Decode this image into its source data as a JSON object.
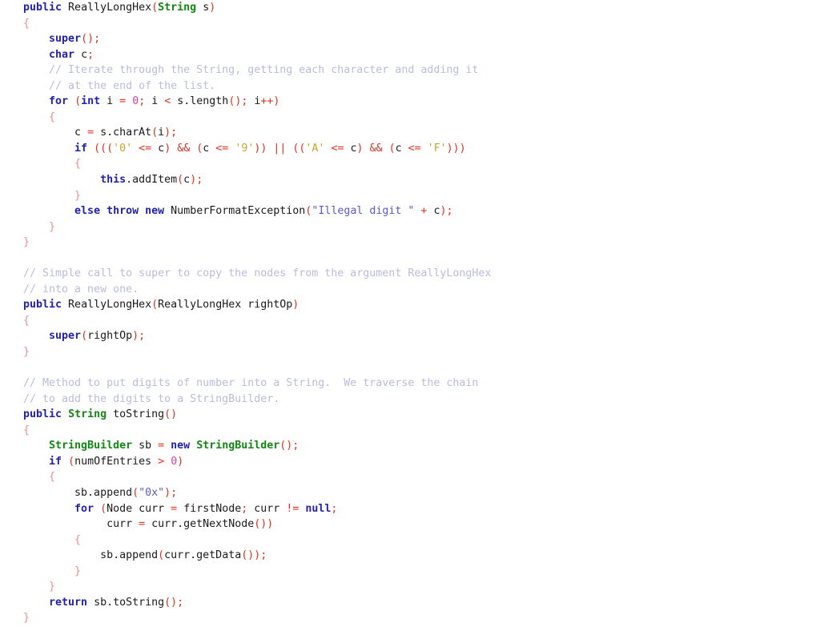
{
  "editor": {
    "language": "Java",
    "class_name": "ReallyLongHex",
    "background_color": "#ffffff",
    "plain_text_color": "#1a1a1a",
    "theme": {
      "keyword_color": "#2222aa",
      "type_color": "#128712",
      "comment_color": "#b9bcdb",
      "string_color": "#5a5ac8",
      "char_literal_color": "#c8a32a",
      "number_color": "#d4419c",
      "punctuation_color": "#dd3322",
      "brace_color": "#e89090"
    }
  },
  "code": {
    "lines": [
      {
        "n": 1,
        "tokens": [
          {
            "t": "kw",
            "v": "public"
          },
          {
            "t": "plain",
            "v": " ReallyLongHex"
          },
          {
            "t": "punc",
            "v": "("
          },
          {
            "t": "type",
            "v": "String"
          },
          {
            "t": "plain",
            "v": " s"
          },
          {
            "t": "punc",
            "v": ")"
          }
        ]
      },
      {
        "n": 2,
        "tokens": [
          {
            "t": "brace",
            "v": "{"
          }
        ]
      },
      {
        "n": 3,
        "tokens": [
          {
            "t": "plain",
            "v": "    "
          },
          {
            "t": "kw",
            "v": "super"
          },
          {
            "t": "punc",
            "v": "();"
          }
        ]
      },
      {
        "n": 4,
        "tokens": [
          {
            "t": "plain",
            "v": "    "
          },
          {
            "t": "kw",
            "v": "char"
          },
          {
            "t": "plain",
            "v": " c"
          },
          {
            "t": "punc",
            "v": ";"
          }
        ]
      },
      {
        "n": 5,
        "tokens": [
          {
            "t": "plain",
            "v": "    "
          },
          {
            "t": "comment",
            "v": "// Iterate through the String, getting each character and adding it"
          }
        ]
      },
      {
        "n": 6,
        "tokens": [
          {
            "t": "plain",
            "v": "    "
          },
          {
            "t": "comment",
            "v": "// at the end of the list."
          }
        ]
      },
      {
        "n": 7,
        "tokens": [
          {
            "t": "plain",
            "v": "    "
          },
          {
            "t": "kw",
            "v": "for"
          },
          {
            "t": "plain",
            "v": " "
          },
          {
            "t": "punc",
            "v": "("
          },
          {
            "t": "kw",
            "v": "int"
          },
          {
            "t": "plain",
            "v": " i "
          },
          {
            "t": "punc",
            "v": "="
          },
          {
            "t": "plain",
            "v": " "
          },
          {
            "t": "num",
            "v": "0"
          },
          {
            "t": "punc",
            "v": ";"
          },
          {
            "t": "plain",
            "v": " i "
          },
          {
            "t": "punc",
            "v": "<"
          },
          {
            "t": "plain",
            "v": " s.length"
          },
          {
            "t": "punc",
            "v": "();"
          },
          {
            "t": "plain",
            "v": " i"
          },
          {
            "t": "punc",
            "v": "++)"
          }
        ]
      },
      {
        "n": 8,
        "tokens": [
          {
            "t": "plain",
            "v": "    "
          },
          {
            "t": "brace",
            "v": "{"
          }
        ]
      },
      {
        "n": 9,
        "tokens": [
          {
            "t": "plain",
            "v": "        c "
          },
          {
            "t": "punc",
            "v": "="
          },
          {
            "t": "plain",
            "v": " s.charAt"
          },
          {
            "t": "punc",
            "v": "("
          },
          {
            "t": "plain",
            "v": "i"
          },
          {
            "t": "punc",
            "v": ");"
          }
        ]
      },
      {
        "n": 10,
        "tokens": [
          {
            "t": "plain",
            "v": "        "
          },
          {
            "t": "kw",
            "v": "if"
          },
          {
            "t": "plain",
            "v": " "
          },
          {
            "t": "punc",
            "v": "((("
          },
          {
            "t": "char",
            "v": "'0'"
          },
          {
            "t": "plain",
            "v": " "
          },
          {
            "t": "punc",
            "v": "<="
          },
          {
            "t": "plain",
            "v": " c"
          },
          {
            "t": "punc",
            "v": ")"
          },
          {
            "t": "plain",
            "v": " "
          },
          {
            "t": "punc",
            "v": "&&"
          },
          {
            "t": "plain",
            "v": " "
          },
          {
            "t": "punc",
            "v": "("
          },
          {
            "t": "plain",
            "v": "c "
          },
          {
            "t": "punc",
            "v": "<="
          },
          {
            "t": "plain",
            "v": " "
          },
          {
            "t": "char",
            "v": "'9'"
          },
          {
            "t": "punc",
            "v": "))"
          },
          {
            "t": "plain",
            "v": " "
          },
          {
            "t": "punc",
            "v": "||"
          },
          {
            "t": "plain",
            "v": " "
          },
          {
            "t": "punc",
            "v": "(("
          },
          {
            "t": "char",
            "v": "'A'"
          },
          {
            "t": "plain",
            "v": " "
          },
          {
            "t": "punc",
            "v": "<="
          },
          {
            "t": "plain",
            "v": " c"
          },
          {
            "t": "punc",
            "v": ")"
          },
          {
            "t": "plain",
            "v": " "
          },
          {
            "t": "punc",
            "v": "&&"
          },
          {
            "t": "plain",
            "v": " "
          },
          {
            "t": "punc",
            "v": "("
          },
          {
            "t": "plain",
            "v": "c "
          },
          {
            "t": "punc",
            "v": "<="
          },
          {
            "t": "plain",
            "v": " "
          },
          {
            "t": "char",
            "v": "'F'"
          },
          {
            "t": "punc",
            "v": ")))"
          }
        ]
      },
      {
        "n": 11,
        "tokens": [
          {
            "t": "plain",
            "v": "        "
          },
          {
            "t": "brace",
            "v": "{"
          }
        ]
      },
      {
        "n": 12,
        "tokens": [
          {
            "t": "plain",
            "v": "            "
          },
          {
            "t": "kw",
            "v": "this"
          },
          {
            "t": "plain",
            "v": ".addItem"
          },
          {
            "t": "punc",
            "v": "("
          },
          {
            "t": "plain",
            "v": "c"
          },
          {
            "t": "punc",
            "v": ");"
          }
        ]
      },
      {
        "n": 13,
        "tokens": [
          {
            "t": "plain",
            "v": "        "
          },
          {
            "t": "brace",
            "v": "}"
          }
        ]
      },
      {
        "n": 14,
        "tokens": [
          {
            "t": "plain",
            "v": "        "
          },
          {
            "t": "kw",
            "v": "else"
          },
          {
            "t": "plain",
            "v": " "
          },
          {
            "t": "kw",
            "v": "throw"
          },
          {
            "t": "plain",
            "v": " "
          },
          {
            "t": "kw",
            "v": "new"
          },
          {
            "t": "plain",
            "v": " NumberFormatException"
          },
          {
            "t": "punc",
            "v": "("
          },
          {
            "t": "string",
            "v": "\"Illegal digit \""
          },
          {
            "t": "plain",
            "v": " "
          },
          {
            "t": "punc",
            "v": "+"
          },
          {
            "t": "plain",
            "v": " c"
          },
          {
            "t": "punc",
            "v": ");"
          }
        ]
      },
      {
        "n": 15,
        "tokens": [
          {
            "t": "plain",
            "v": "    "
          },
          {
            "t": "brace",
            "v": "}"
          }
        ]
      },
      {
        "n": 16,
        "tokens": [
          {
            "t": "brace",
            "v": "}"
          }
        ]
      },
      {
        "n": 17,
        "tokens": [
          {
            "t": "blank",
            "v": " "
          }
        ]
      },
      {
        "n": 18,
        "tokens": [
          {
            "t": "comment",
            "v": "// Simple call to super to copy the nodes from the argument ReallyLongHex"
          }
        ]
      },
      {
        "n": 19,
        "tokens": [
          {
            "t": "comment",
            "v": "// into a new one."
          }
        ]
      },
      {
        "n": 20,
        "tokens": [
          {
            "t": "kw",
            "v": "public"
          },
          {
            "t": "plain",
            "v": " ReallyLongHex"
          },
          {
            "t": "punc",
            "v": "("
          },
          {
            "t": "plain",
            "v": "ReallyLongHex rightOp"
          },
          {
            "t": "punc",
            "v": ")"
          }
        ]
      },
      {
        "n": 21,
        "tokens": [
          {
            "t": "brace",
            "v": "{"
          }
        ]
      },
      {
        "n": 22,
        "tokens": [
          {
            "t": "plain",
            "v": "    "
          },
          {
            "t": "kw",
            "v": "super"
          },
          {
            "t": "punc",
            "v": "("
          },
          {
            "t": "plain",
            "v": "rightOp"
          },
          {
            "t": "punc",
            "v": ");"
          }
        ]
      },
      {
        "n": 23,
        "tokens": [
          {
            "t": "brace",
            "v": "}"
          }
        ]
      },
      {
        "n": 24,
        "tokens": [
          {
            "t": "blank",
            "v": " "
          }
        ]
      },
      {
        "n": 25,
        "tokens": [
          {
            "t": "comment",
            "v": "// Method to put digits of number into a String.  We traverse the chain"
          }
        ]
      },
      {
        "n": 26,
        "tokens": [
          {
            "t": "comment",
            "v": "// to add the digits to a StringBuilder."
          }
        ]
      },
      {
        "n": 27,
        "tokens": [
          {
            "t": "kw",
            "v": "public"
          },
          {
            "t": "plain",
            "v": " "
          },
          {
            "t": "type",
            "v": "String"
          },
          {
            "t": "plain",
            "v": " toString"
          },
          {
            "t": "punc",
            "v": "()"
          }
        ]
      },
      {
        "n": 28,
        "tokens": [
          {
            "t": "brace",
            "v": "{"
          }
        ]
      },
      {
        "n": 29,
        "tokens": [
          {
            "t": "plain",
            "v": "    "
          },
          {
            "t": "type",
            "v": "StringBuilder"
          },
          {
            "t": "plain",
            "v": " sb "
          },
          {
            "t": "punc",
            "v": "="
          },
          {
            "t": "plain",
            "v": " "
          },
          {
            "t": "kw",
            "v": "new"
          },
          {
            "t": "plain",
            "v": " "
          },
          {
            "t": "type",
            "v": "StringBuilder"
          },
          {
            "t": "punc",
            "v": "();"
          }
        ]
      },
      {
        "n": 30,
        "tokens": [
          {
            "t": "plain",
            "v": "    "
          },
          {
            "t": "kw",
            "v": "if"
          },
          {
            "t": "plain",
            "v": " "
          },
          {
            "t": "punc",
            "v": "("
          },
          {
            "t": "plain",
            "v": "numOfEntries "
          },
          {
            "t": "punc",
            "v": ">"
          },
          {
            "t": "plain",
            "v": " "
          },
          {
            "t": "num",
            "v": "0"
          },
          {
            "t": "punc",
            "v": ")"
          }
        ]
      },
      {
        "n": 31,
        "tokens": [
          {
            "t": "plain",
            "v": "    "
          },
          {
            "t": "brace",
            "v": "{"
          }
        ]
      },
      {
        "n": 32,
        "tokens": [
          {
            "t": "plain",
            "v": "        sb.append"
          },
          {
            "t": "punc",
            "v": "("
          },
          {
            "t": "string",
            "v": "\"0x\""
          },
          {
            "t": "punc",
            "v": ");"
          }
        ]
      },
      {
        "n": 33,
        "tokens": [
          {
            "t": "plain",
            "v": "        "
          },
          {
            "t": "kw",
            "v": "for"
          },
          {
            "t": "plain",
            "v": " "
          },
          {
            "t": "punc",
            "v": "("
          },
          {
            "t": "plain",
            "v": "Node curr "
          },
          {
            "t": "punc",
            "v": "="
          },
          {
            "t": "plain",
            "v": " firstNode"
          },
          {
            "t": "punc",
            "v": ";"
          },
          {
            "t": "plain",
            "v": " curr "
          },
          {
            "t": "punc",
            "v": "!="
          },
          {
            "t": "plain",
            "v": " "
          },
          {
            "t": "kw",
            "v": "null"
          },
          {
            "t": "punc",
            "v": ";"
          }
        ]
      },
      {
        "n": 34,
        "tokens": [
          {
            "t": "plain",
            "v": "             curr "
          },
          {
            "t": "punc",
            "v": "="
          },
          {
            "t": "plain",
            "v": " curr.getNextNode"
          },
          {
            "t": "punc",
            "v": "())"
          }
        ]
      },
      {
        "n": 35,
        "tokens": [
          {
            "t": "plain",
            "v": "        "
          },
          {
            "t": "brace",
            "v": "{"
          }
        ]
      },
      {
        "n": 36,
        "tokens": [
          {
            "t": "plain",
            "v": "            sb.append"
          },
          {
            "t": "punc",
            "v": "("
          },
          {
            "t": "plain",
            "v": "curr.getData"
          },
          {
            "t": "punc",
            "v": "());"
          }
        ]
      },
      {
        "n": 37,
        "tokens": [
          {
            "t": "plain",
            "v": "        "
          },
          {
            "t": "brace",
            "v": "}"
          }
        ]
      },
      {
        "n": 38,
        "tokens": [
          {
            "t": "plain",
            "v": "    "
          },
          {
            "t": "brace",
            "v": "}"
          }
        ]
      },
      {
        "n": 39,
        "tokens": [
          {
            "t": "plain",
            "v": "    "
          },
          {
            "t": "kw",
            "v": "return"
          },
          {
            "t": "plain",
            "v": " sb.toString"
          },
          {
            "t": "punc",
            "v": "();"
          }
        ]
      },
      {
        "n": 40,
        "tokens": [
          {
            "t": "brace",
            "v": "}"
          }
        ]
      }
    ]
  }
}
